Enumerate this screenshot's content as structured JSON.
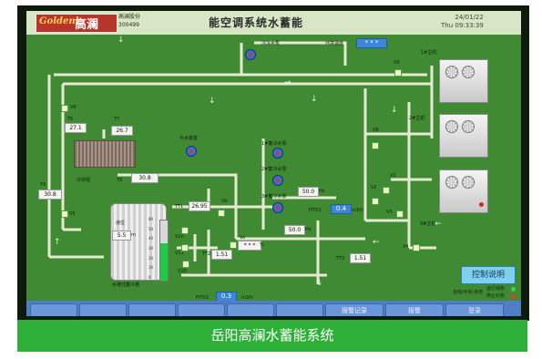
{
  "header": {
    "logo_en": "Goldenl",
    "logo_cn": "高澜",
    "stock_line1": "高澜股份",
    "stock_line2": "300499",
    "title": "能空调系统水蓄能",
    "date": "24/01/22",
    "time": "Thu 09:33:39"
  },
  "top_labels": {
    "frozen_pump": "冷冻水泵",
    "env_temp": "环境温度",
    "env_value": "* * *",
    "unit1": "1#主机",
    "unit2": "2#主机",
    "unit3": "3#主机"
  },
  "left": {
    "t6_label": "V6",
    "t5_label": "T5",
    "t7_label": "T7",
    "t5_value": "27.1",
    "t7_value": "26.7",
    "tower_label": "冷却塔",
    "t8_label": "T8",
    "t8_value": "30.8",
    "t4_label": "T4",
    "t4_value": "30.8",
    "v5_label": "V5",
    "makeup_label": "补水装置"
  },
  "pumps": {
    "p1": "1#蓄冷水泵",
    "p2": "2#蓄冷水泵",
    "p3": "3#蓄冷水泵",
    "flow_top": "50.0",
    "flow_bottom": "50.0",
    "flow_unit": "Hz"
  },
  "mid": {
    "tt1_label": "TT1",
    "tt1_value": "26.95",
    "vb_label": "Vb",
    "va_label": "Va",
    "va_value": "* * *",
    "va_unit": "%",
    "tt2_label": "TT2",
    "tt2_value": "1.51",
    "v10": "V10",
    "v11": "V11",
    "v20": "V20",
    "fit01_label": "FIT01",
    "fit01_value": "0.4",
    "fit01_unit": "m3/h",
    "fit02_label": "FIT02",
    "fit02_value": "0.3",
    "fit02_unit": "m3/h",
    "tt3_label": "TT3",
    "tt3_value": "1.51"
  },
  "tank": {
    "level_label": "液位",
    "level_value": "5.5",
    "level_unit": "m",
    "level_fraction": 0.62,
    "name": "水槽式蓄冷槽",
    "scale": [
      "60",
      "50",
      "40",
      "30",
      "20",
      "10",
      "0"
    ]
  },
  "right": {
    "v1": "V1",
    "v2": "V2",
    "v3": "V3",
    "v4": "V4",
    "v8": "V8",
    "v9": "V9",
    "control_button": "控制说明",
    "auto_label": "自动/手动 状态",
    "legend_run": "运行绿色",
    "legend_stop": "停止红色"
  },
  "tabs": [
    "",
    "",
    "",
    "",
    "",
    "",
    "报警记录",
    "报警",
    "登录"
  ],
  "caption": "岳阳高澜水蓄能系统",
  "colors": {
    "panel": "#3f8a33",
    "pipe": "#e6ead0",
    "banner": "#2eb038",
    "tab": "#4f7ec7"
  }
}
